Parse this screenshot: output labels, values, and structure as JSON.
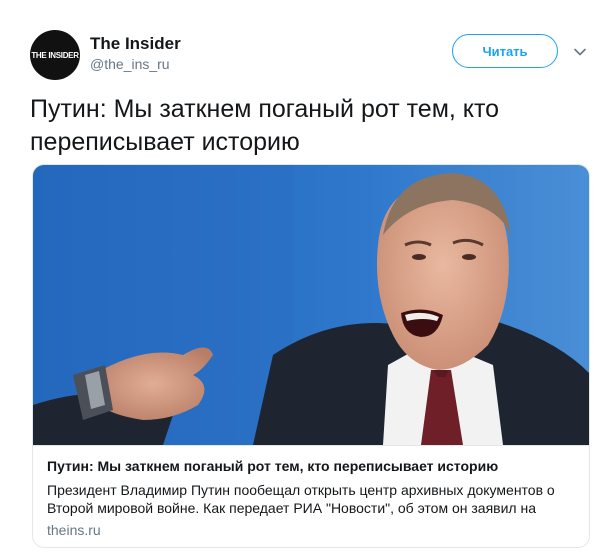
{
  "account": {
    "avatar_text": "THE INSIDER",
    "name": "The Insider",
    "handle": "@the_ins_ru"
  },
  "follow_button_label": "Читать",
  "tweet_text": "Путин: Мы заткнем поганый рот тем, кто переписывает историю",
  "card": {
    "title": "Путин: Мы заткнем поганый рот тем, кто переписывает историю",
    "description": "Президент Владимир Путин пообещал открыть центр архивных документов о Второй мировой войне. Как передает РИА \"Новости\", об этом он заявил на",
    "domain": "theins.ru"
  },
  "colors": {
    "accent": "#1da1f2",
    "secondary_text": "#657786",
    "border": "#e1e8ed"
  },
  "icons": {
    "menu": "chevron-down-icon"
  }
}
